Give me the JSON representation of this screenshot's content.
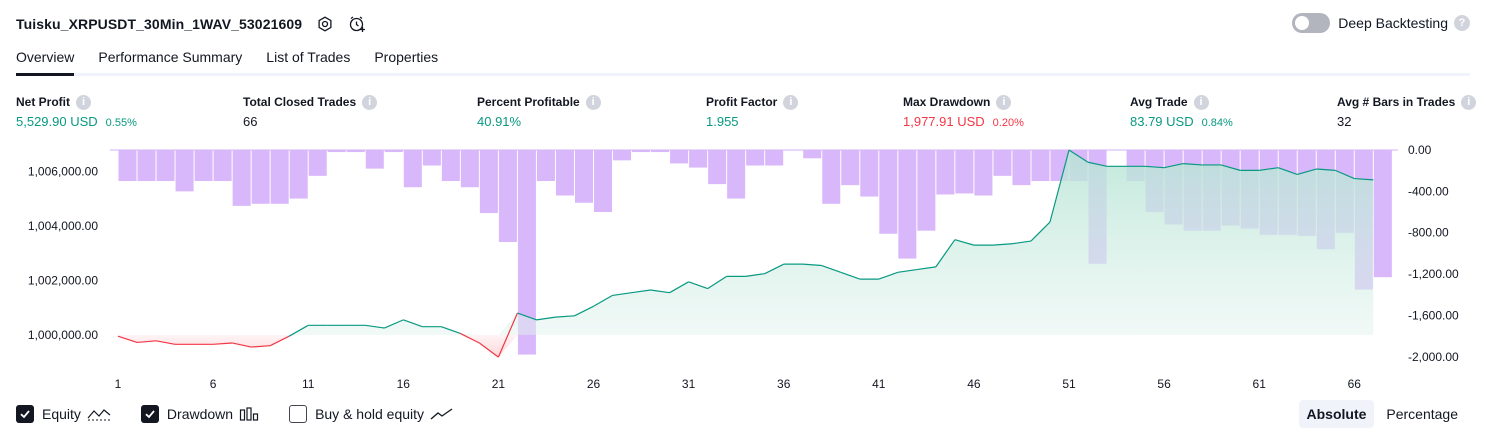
{
  "header": {
    "title": "Tuisku_XRPUSDT_30Min_1WAV_53021609",
    "settings_icon": "gear-icon",
    "alert_icon": "add-alert-icon"
  },
  "deep_backtesting": {
    "label": "Deep Backtesting",
    "enabled": false,
    "help": "?"
  },
  "tabs": [
    {
      "label": "Overview",
      "active": true
    },
    {
      "label": "Performance Summary",
      "active": false
    },
    {
      "label": "List of Trades",
      "active": false
    },
    {
      "label": "Properties",
      "active": false
    }
  ],
  "metrics": {
    "net_profit": {
      "label": "Net Profit",
      "value": "5,529.90 USD",
      "sub": "0.55%"
    },
    "total_closed_trades": {
      "label": "Total Closed Trades",
      "value": "66"
    },
    "percent_profitable": {
      "label": "Percent Profitable",
      "value": "40.91%"
    },
    "profit_factor": {
      "label": "Profit Factor",
      "value": "1.955"
    },
    "max_drawdown": {
      "label": "Max Drawdown",
      "value": "1,977.91 USD",
      "sub": "0.20%"
    },
    "avg_trade": {
      "label": "Avg Trade",
      "value": "83.79 USD",
      "sub": "0.84%"
    },
    "avg_bars": {
      "label": "Avg # Bars in Trades",
      "value": "32"
    },
    "help": "i"
  },
  "colors": {
    "profit": "#089981",
    "loss": "#f23645",
    "drawdown_bar": "#d9b7fb",
    "equity_fill": "#e1f3ee",
    "text": "#131722"
  },
  "chart_data": {
    "type": "line",
    "equity": {
      "name": "Equity",
      "ylim": [
        999000,
        1006800
      ],
      "ticks": [
        "1,006,000.00",
        "1,004,000.00",
        "1,002,000.00",
        "1,000,000.00"
      ],
      "tick_values": [
        1006000,
        1004000,
        1002000,
        1000000
      ],
      "baseline": 1000000,
      "x": [
        1,
        2,
        3,
        4,
        5,
        6,
        7,
        8,
        9,
        10,
        11,
        12,
        13,
        14,
        15,
        16,
        17,
        18,
        19,
        20,
        21,
        22,
        23,
        24,
        25,
        26,
        27,
        28,
        29,
        30,
        31,
        32,
        33,
        34,
        35,
        36,
        37,
        38,
        39,
        40,
        41,
        42,
        43,
        44,
        45,
        46,
        47,
        48,
        49,
        50,
        51,
        52,
        53,
        54,
        55,
        56,
        57,
        58,
        59,
        60,
        61,
        62,
        63,
        64,
        65,
        66,
        67
      ],
      "values": [
        999950,
        999720,
        999780,
        999650,
        999650,
        999650,
        999700,
        999550,
        999600,
        999950,
        1000350,
        1000350,
        1000350,
        1000350,
        1000250,
        1000550,
        1000300,
        1000300,
        1000050,
        999700,
        999180,
        1000800,
        1000550,
        1000650,
        1000700,
        1001050,
        1001450,
        1001550,
        1001650,
        1001550,
        1001950,
        1001700,
        1002150,
        1002150,
        1002250,
        1002600,
        1002600,
        1002550,
        1002300,
        1002050,
        1002050,
        1002300,
        1002400,
        1002500,
        1003500,
        1003300,
        1003300,
        1003350,
        1003450,
        1004150,
        1006800,
        1006350,
        1006200,
        1006200,
        1006200,
        1006150,
        1006300,
        1006250,
        1006250,
        1006050,
        1006050,
        1006150,
        1005900,
        1006100,
        1006050,
        1005750,
        1005700
      ]
    },
    "drawdown": {
      "name": "Drawdown",
      "ylim": [
        -2050,
        0
      ],
      "ticks": [
        "0.00",
        "-400.00",
        "-800.00",
        "-1,200.00",
        "-1,600.00",
        "-2,000.00"
      ],
      "tick_values": [
        0,
        -400,
        -800,
        -1200,
        -1600,
        -2000
      ],
      "values": [
        -300,
        -300,
        -300,
        -400,
        -300,
        -300,
        -540,
        -520,
        -520,
        -470,
        -250,
        -20,
        -20,
        -180,
        -20,
        -360,
        -150,
        -300,
        -360,
        -610,
        -890,
        -1978,
        -300,
        -440,
        -510,
        -600,
        -100,
        -20,
        -20,
        -130,
        -170,
        -330,
        -470,
        -150,
        -150,
        0,
        -80,
        -520,
        -340,
        -450,
        -810,
        -1050,
        -780,
        -430,
        -420,
        -440,
        -250,
        -340,
        -300,
        -300,
        -300,
        -1100,
        0,
        -300,
        -600,
        -720,
        -780,
        -780,
        -730,
        -760,
        -820,
        -820,
        -830,
        -960,
        -800,
        -1350,
        -1230
      ]
    },
    "x_ticks": [
      "1",
      "6",
      "11",
      "16",
      "21",
      "26",
      "31",
      "36",
      "41",
      "46",
      "51",
      "56",
      "61",
      "66"
    ],
    "x_tick_values": [
      1,
      6,
      11,
      16,
      21,
      26,
      31,
      36,
      41,
      46,
      51,
      56,
      61,
      66
    ],
    "grid": false,
    "legend": "bottom-left"
  },
  "legend": {
    "equity": {
      "label": "Equity",
      "checked": true,
      "icon": "equity-line-icon"
    },
    "drawdown": {
      "label": "Drawdown",
      "checked": true,
      "icon": "drawdown-bars-icon"
    },
    "buy_hold": {
      "label": "Buy & hold equity",
      "checked": false,
      "icon": "buy-hold-line-icon"
    }
  },
  "display_mode": {
    "absolute": "Absolute",
    "percentage": "Percentage",
    "selected": "Absolute"
  }
}
